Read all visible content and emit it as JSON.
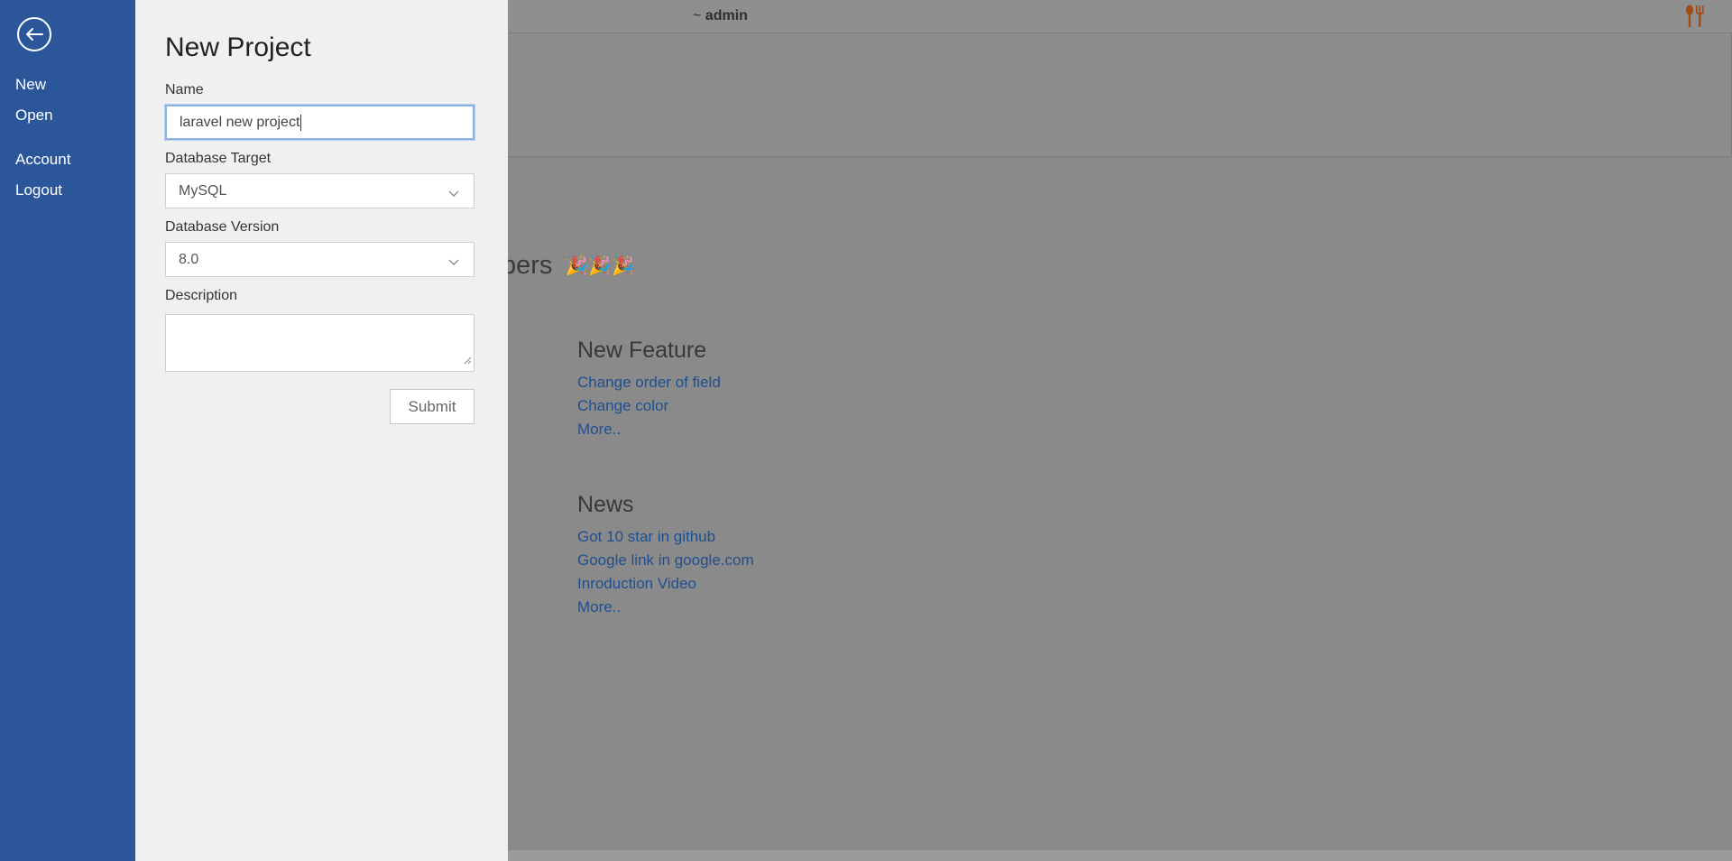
{
  "header": {
    "user_prefix": "~",
    "username": "admin",
    "brand_icon": "fork-spoon-icon"
  },
  "background": {
    "welcome_text_visible": "pers",
    "confetti": "🎉🎉🎉",
    "new_feature": {
      "title": "New Feature",
      "links": [
        "Change order of field",
        "Change color",
        "More.."
      ]
    },
    "news": {
      "title": "News",
      "links": [
        "Got 10 star in github",
        "Google link in google.com",
        "Inroduction Video",
        "More.."
      ]
    }
  },
  "sidebar": {
    "back_icon": "back-arrow-icon",
    "items": [
      {
        "label": "New"
      },
      {
        "label": "Open"
      },
      {
        "label": "Account"
      },
      {
        "label": "Logout"
      }
    ]
  },
  "form": {
    "title": "New Project",
    "name_label": "Name",
    "name_value": "laravel new project",
    "db_target_label": "Database Target",
    "db_target_value": "MySQL",
    "db_version_label": "Database Version",
    "db_version_value": "8.0",
    "description_label": "Description",
    "description_value": "",
    "submit_label": "Submit"
  },
  "colors": {
    "sidebar": "#2b579a",
    "panel": "#f0f0f0",
    "link": "#1f4f8f",
    "overlay": "#8a8a8a"
  }
}
